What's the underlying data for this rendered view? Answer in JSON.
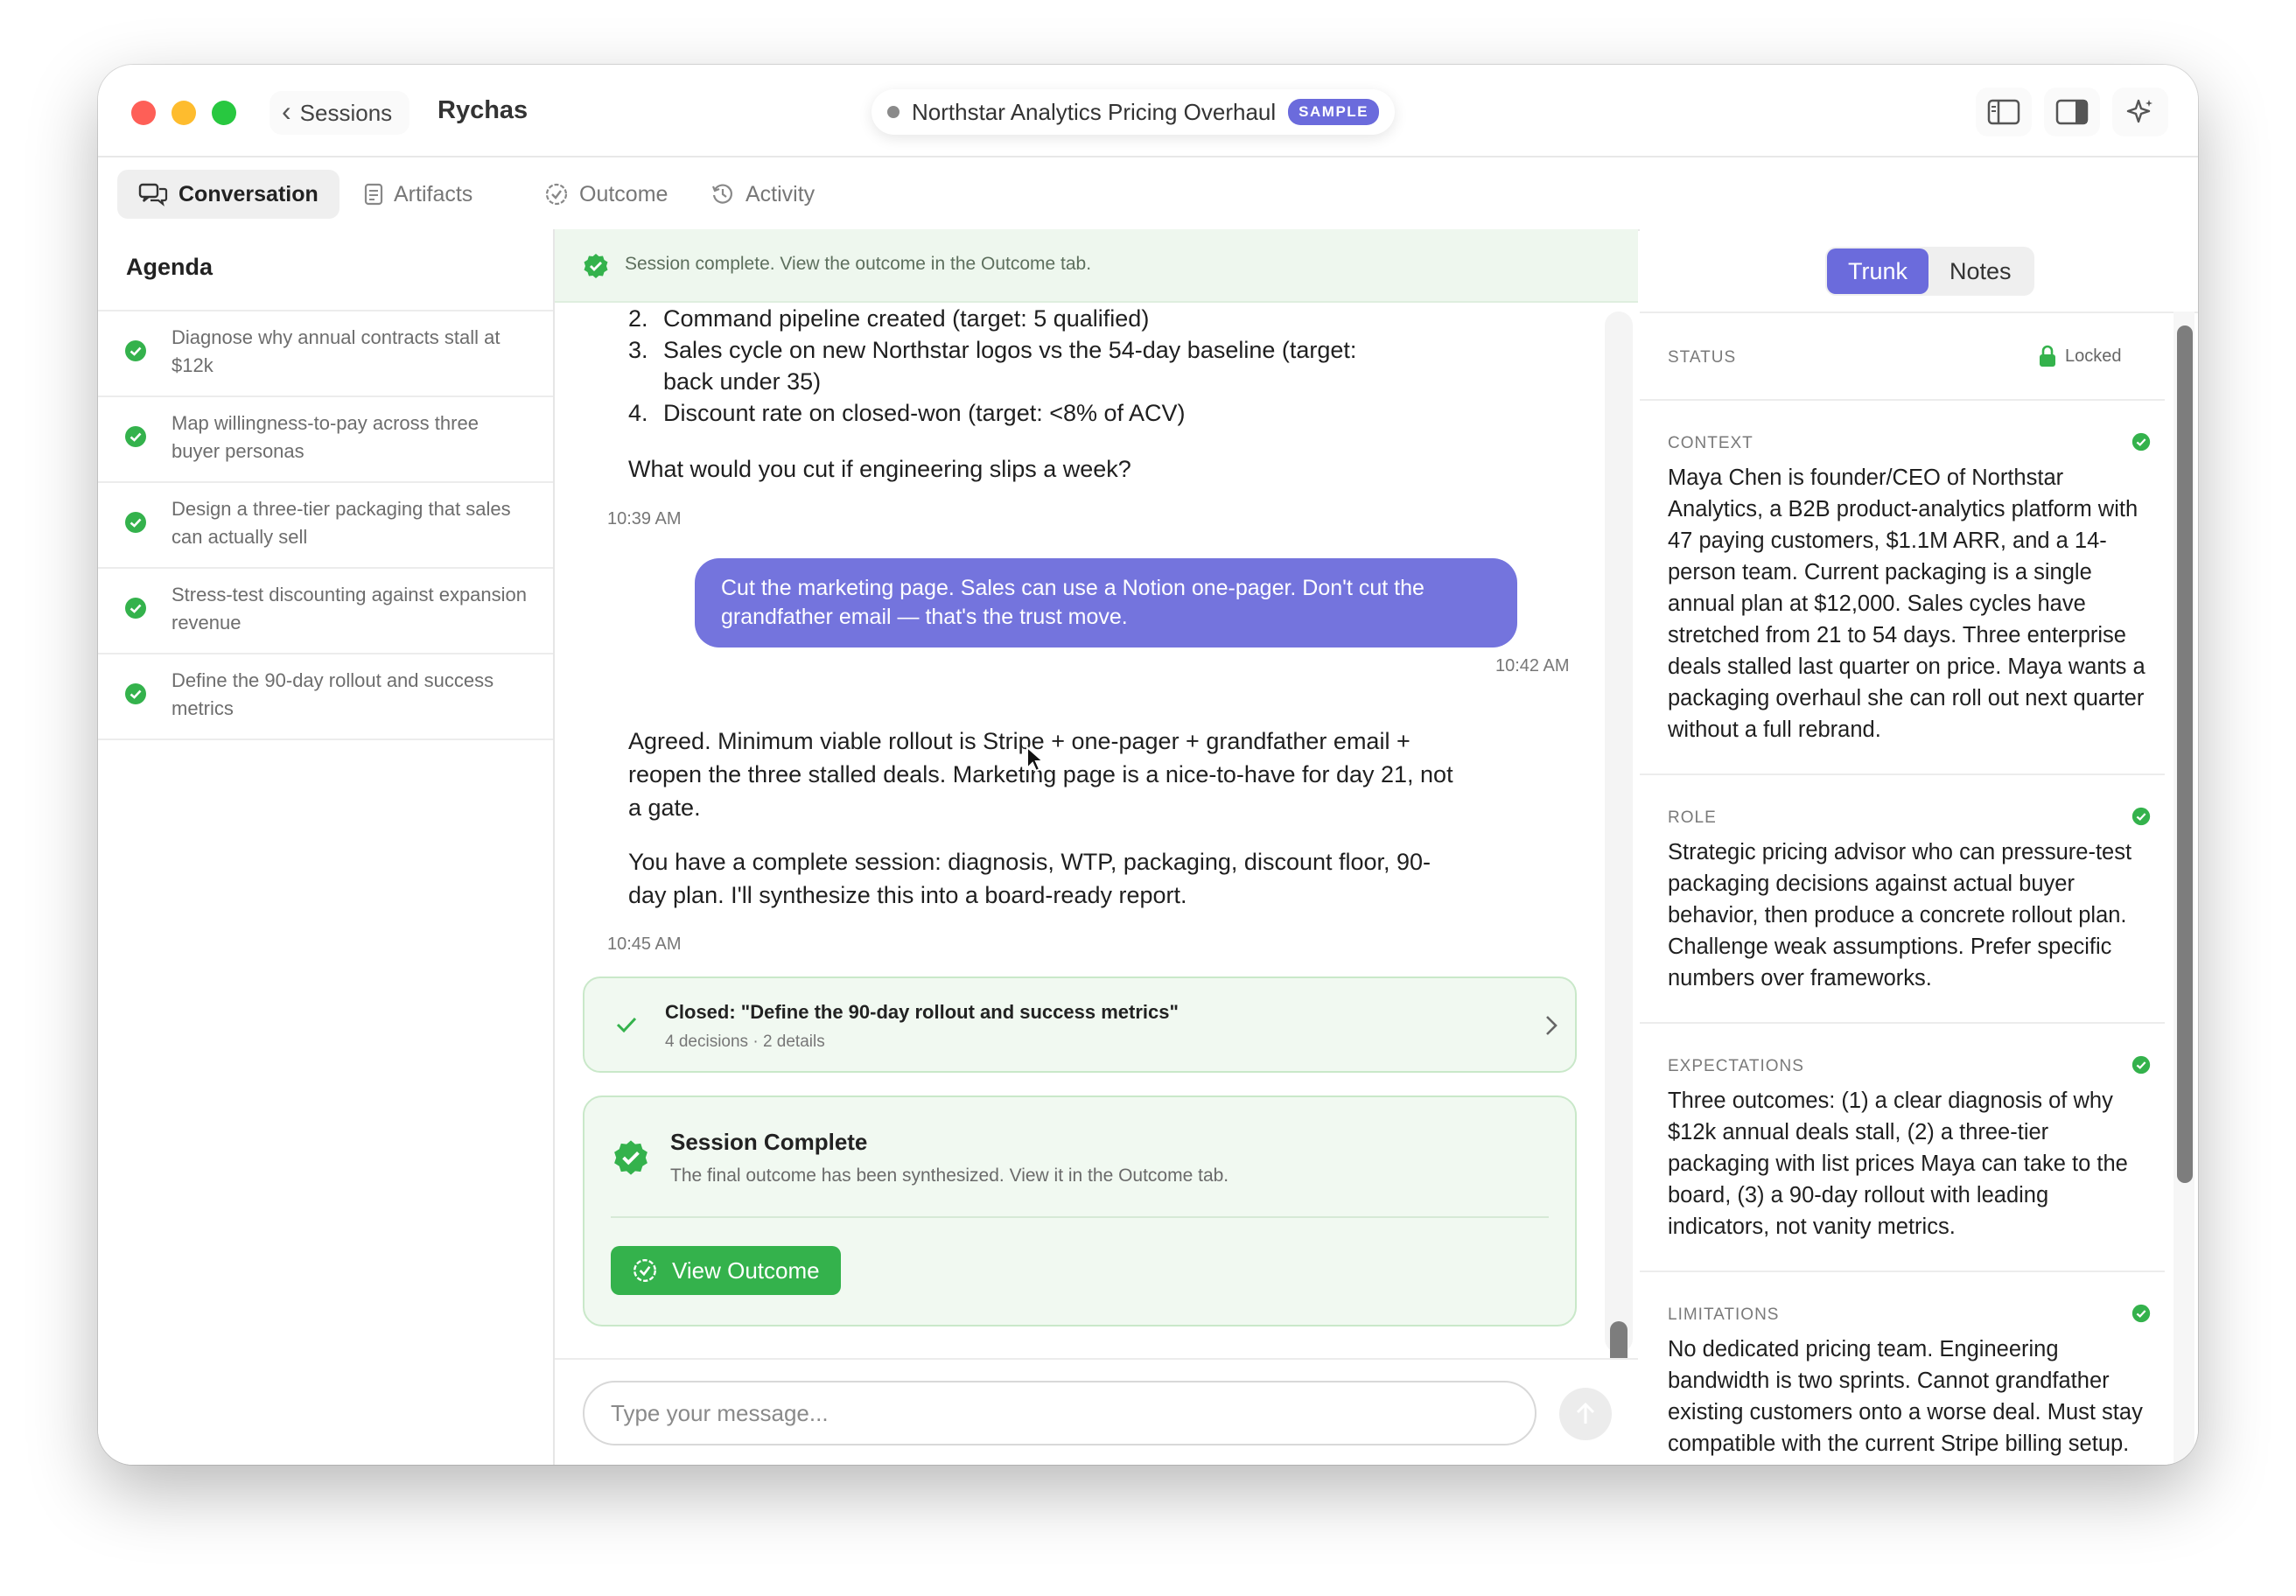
{
  "header": {
    "back_label": "Sessions",
    "app_name": "Rychas",
    "session_title": "Northstar Analytics Pricing Overhaul",
    "badge": "SAMPLE",
    "icons": [
      "sidebar-left-icon",
      "sidebar-right-icon",
      "sparkle-icon"
    ]
  },
  "tabs": [
    {
      "label": "Conversation",
      "icon": "chat-icon",
      "active": true
    },
    {
      "label": "Artifacts",
      "icon": "document-icon",
      "active": false
    },
    {
      "label": "Outcome",
      "icon": "badge-check-icon",
      "active": false
    },
    {
      "label": "Activity",
      "icon": "history-icon",
      "active": false
    }
  ],
  "agenda": {
    "title": "Agenda",
    "items": [
      {
        "label": "Diagnose why annual contracts stall at $12k",
        "done": true
      },
      {
        "label": "Map willingness-to-pay across three buyer personas",
        "done": true
      },
      {
        "label": "Design a three-tier packaging that sales can actually sell",
        "done": true
      },
      {
        "label": "Stress-test discounting against expansion revenue",
        "done": true
      },
      {
        "label": "Define the 90-day rollout and success metrics",
        "done": true
      }
    ]
  },
  "banner": {
    "text": "Session complete. View the outcome in the Outcome tab."
  },
  "chat": {
    "list_items": [
      {
        "num": "2.",
        "text": "Command pipeline created (target: 5 qualified)"
      },
      {
        "num": "3.",
        "text": "Sales cycle on new Northstar logos vs the 54-day baseline (target:",
        "text2": "back under 35)"
      },
      {
        "num": "4.",
        "text": "Discount rate on closed-won (target: <8% of ACV)"
      }
    ],
    "question": "What would you cut if engineering slips a week?",
    "ts1": "10:39 AM",
    "user_message": "Cut the marketing page. Sales can use a Notion one-pager. Don't cut the grandfather email — that's the trust move.",
    "ts2": "10:42 AM",
    "reply_p1": "Agreed. Minimum viable rollout is Stripe + one-pager + grandfather email + reopen the three stalled deals. Marketing page is a nice-to-have for day 21, not a gate.",
    "reply_p2": "You have a complete session: diagnosis, WTP, packaging, discount floor, 90-day plan. I'll synthesize this into a board-ready report.",
    "ts3": "10:45 AM",
    "closed_card": {
      "title": "Closed: \"Define the 90-day rollout and success metrics\"",
      "meta": "4 decisions · 2 details"
    },
    "complete_card": {
      "title": "Session Complete",
      "subtitle": "The final outcome has been synthesized. View it in the Outcome tab.",
      "button": "View Outcome"
    }
  },
  "composer": {
    "placeholder": "Type your message..."
  },
  "right_panel": {
    "segments": [
      "Trunk",
      "Notes"
    ],
    "active_segment": "Trunk",
    "status_label": "STATUS",
    "status_value": "Locked",
    "sections": [
      {
        "label": "CONTEXT",
        "text": "Maya Chen is founder/CEO of Northstar Analytics, a B2B product-analytics platform with 47 paying customers, $1.1M ARR, and a 14-person team. Current packaging is a single annual plan at $12,000. Sales cycles have stretched from 21 to 54 days. Three enterprise deals stalled last quarter on price. Maya wants a packaging overhaul she can roll out next quarter without a full rebrand."
      },
      {
        "label": "ROLE",
        "text": "Strategic pricing advisor who can pressure-test packaging decisions against actual buyer behavior, then produce a concrete rollout plan. Challenge weak assumptions. Prefer specific numbers over frameworks."
      },
      {
        "label": "EXPECTATIONS",
        "text": "Three outcomes: (1) a clear diagnosis of why $12k annual deals stall, (2) a three-tier packaging with list prices Maya can take to the board, (3) a 90-day rollout with leading indicators, not vanity metrics."
      },
      {
        "label": "LIMITATIONS",
        "text": "No dedicated pricing team. Engineering bandwidth is two sprints. Cannot grandfather existing customers onto a worse deal. Must stay compatible with the current Stripe billing setup. Board meeting is in six"
      }
    ]
  },
  "colors": {
    "accent": "#6b6bdc",
    "success": "#34b24c",
    "user_bubble": "#7474dd"
  }
}
